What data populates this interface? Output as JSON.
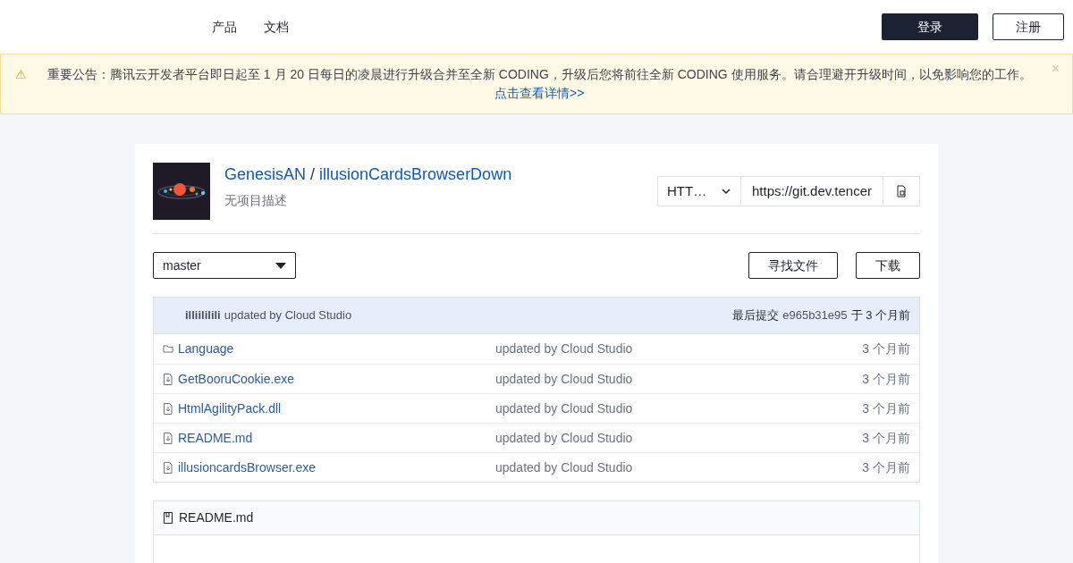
{
  "nav": {
    "items": [
      "产品",
      "文档"
    ],
    "login": "登录",
    "register": "注册"
  },
  "notice": {
    "icon": "⚠",
    "text": "重要公告：腾讯云开发者平台即日起至 1 月 20 日每日的凌晨进行升级合并至全新 CODING，升级后您将前往全新 CODING 使用服务。请合理避开升级时间，以免影响您的工作。",
    "link": "点击查看详情>>",
    "close": "×"
  },
  "repo": {
    "owner": "GenesisAN",
    "separator": "/",
    "name": "illusionCardsBrowserDown",
    "description": "无项目描述",
    "protocol": "HTT…",
    "url": "https://git.dev.tencer"
  },
  "branch": "master",
  "find_button": "寻找文件",
  "download_button": "下载",
  "last_commit": {
    "author": "illiililili",
    "message": "updated by Cloud Studio",
    "label": "最后提交",
    "hash": "e965b31e95",
    "when_prefix": "于",
    "when": "3 个月前"
  },
  "files": [
    {
      "kind": "folder",
      "name": "Language",
      "message": "updated by Cloud Studio",
      "time": "3 个月前"
    },
    {
      "kind": "file",
      "name": "GetBooruCookie.exe",
      "message": "updated by Cloud Studio",
      "time": "3 个月前"
    },
    {
      "kind": "file",
      "name": "HtmlAgilityPack.dll",
      "message": "updated by Cloud Studio",
      "time": "3 个月前"
    },
    {
      "kind": "file",
      "name": "README.md",
      "message": "updated by Cloud Studio",
      "time": "3 个月前"
    },
    {
      "kind": "file",
      "name": "illusioncardsBrowser.exe",
      "message": "updated by Cloud Studio",
      "time": "3 个月前"
    }
  ],
  "readme": {
    "title": "README.md"
  }
}
